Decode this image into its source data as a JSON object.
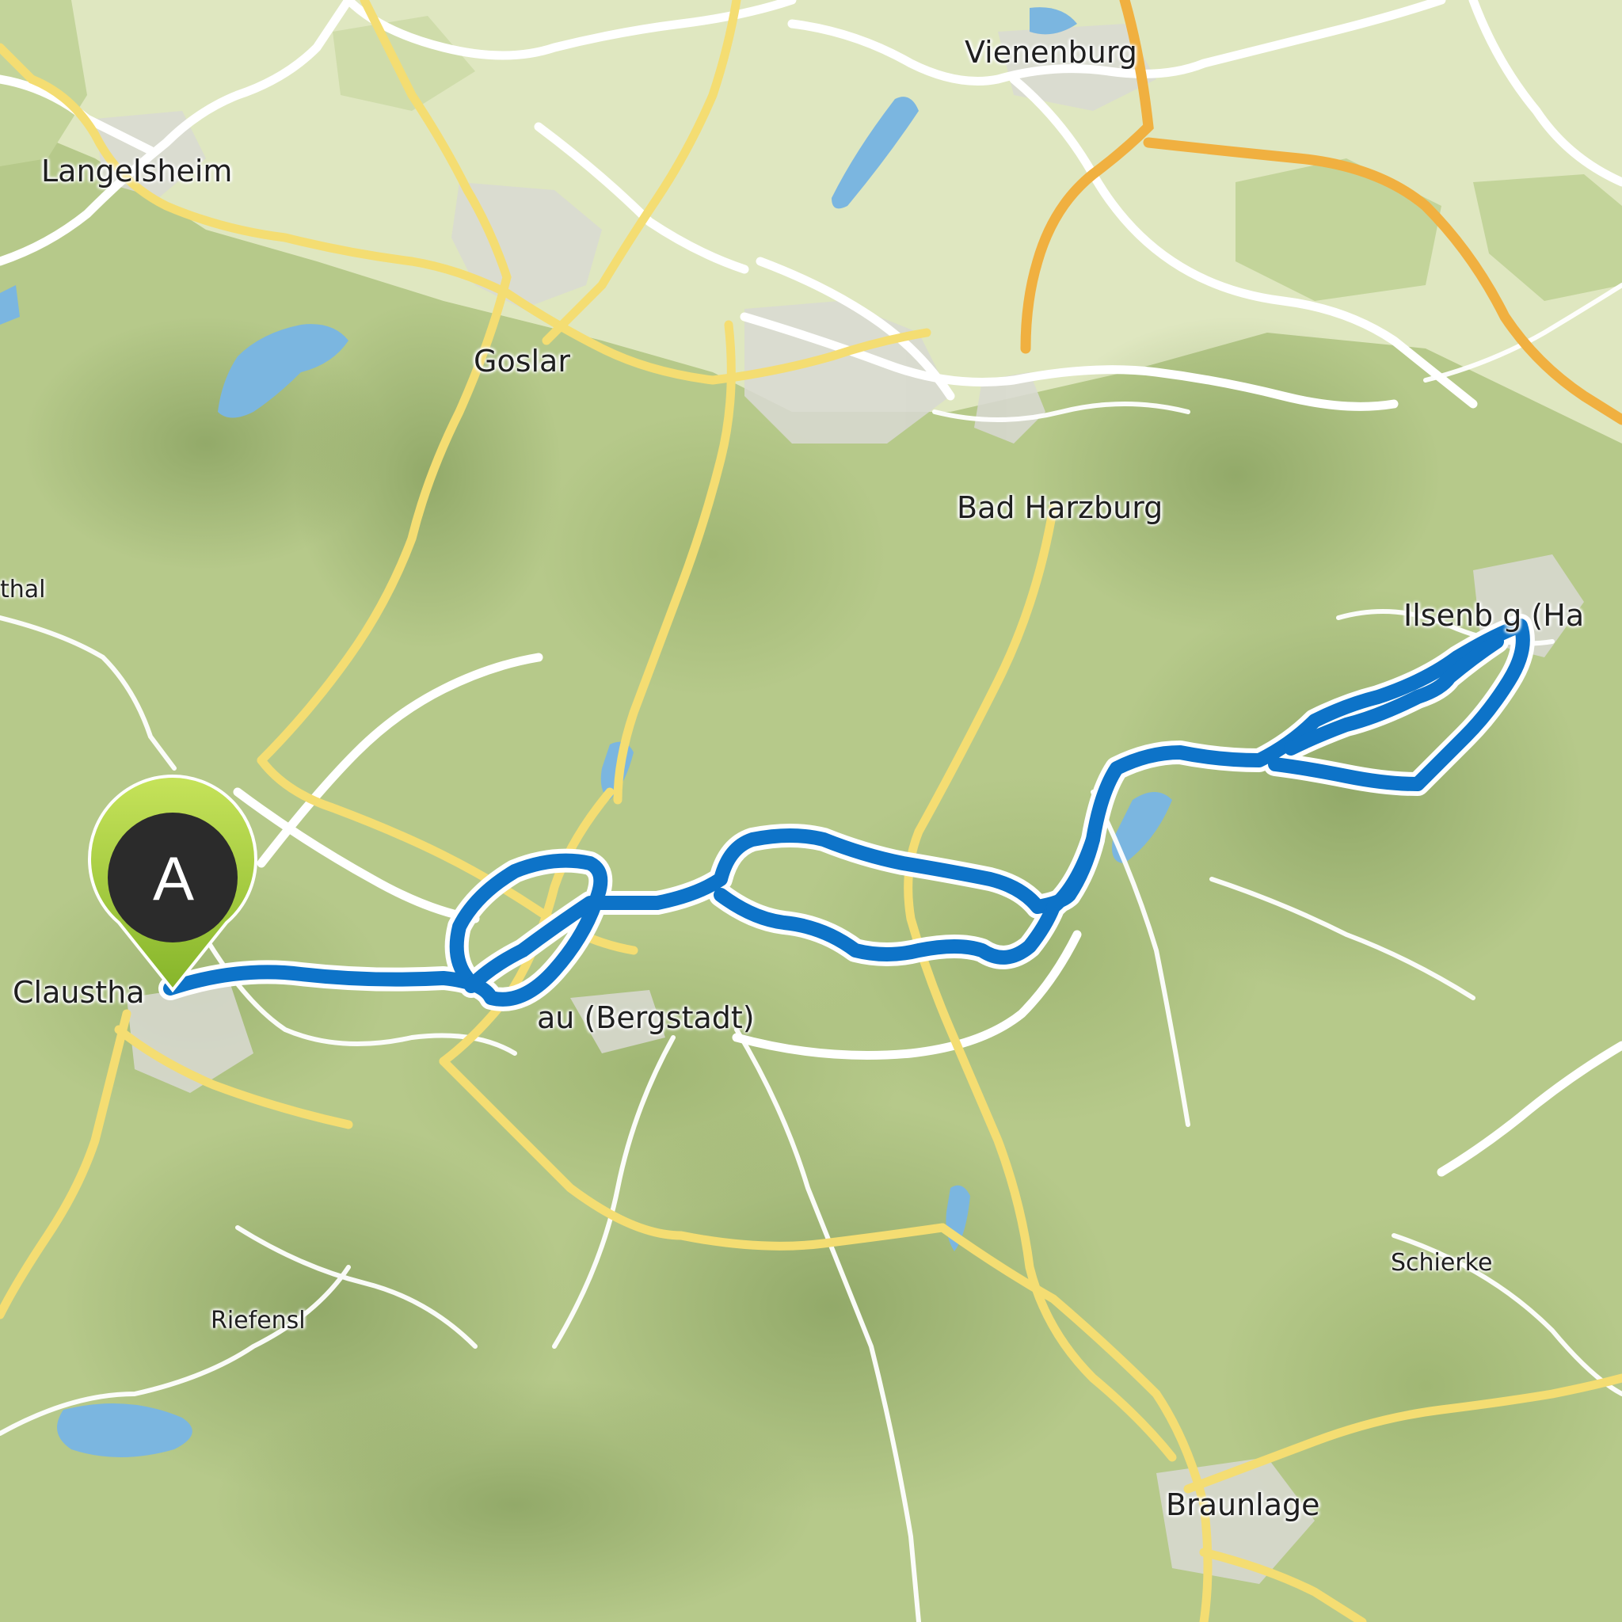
{
  "map": {
    "route_color": "#0d73c8",
    "route_outline_color": "#ffffff",
    "road_major_color": "#f2d86a",
    "motorway_color": "#f0b040",
    "water_color": "#7bb6e0",
    "forest_color": "#b9cc8c",
    "open_land_color": "#dfe7c0"
  },
  "marker": {
    "label": "A",
    "icon": "map-pin-icon",
    "color": "#9ccc3a"
  },
  "places": {
    "vienenburg": "Vienenburg",
    "langelsheim": "Langelsheim",
    "goslar": "Goslar",
    "bad_harzburg": "Bad Harzburg",
    "thal": "thal",
    "ilsenburg": "Ilsenb   g (Ha",
    "clausthal": "Claustha",
    "altenau": "au (Bergstadt)",
    "schierke": "Schierke",
    "riefensbeek": "Riefensl",
    "braunlage": "Braunlage"
  }
}
